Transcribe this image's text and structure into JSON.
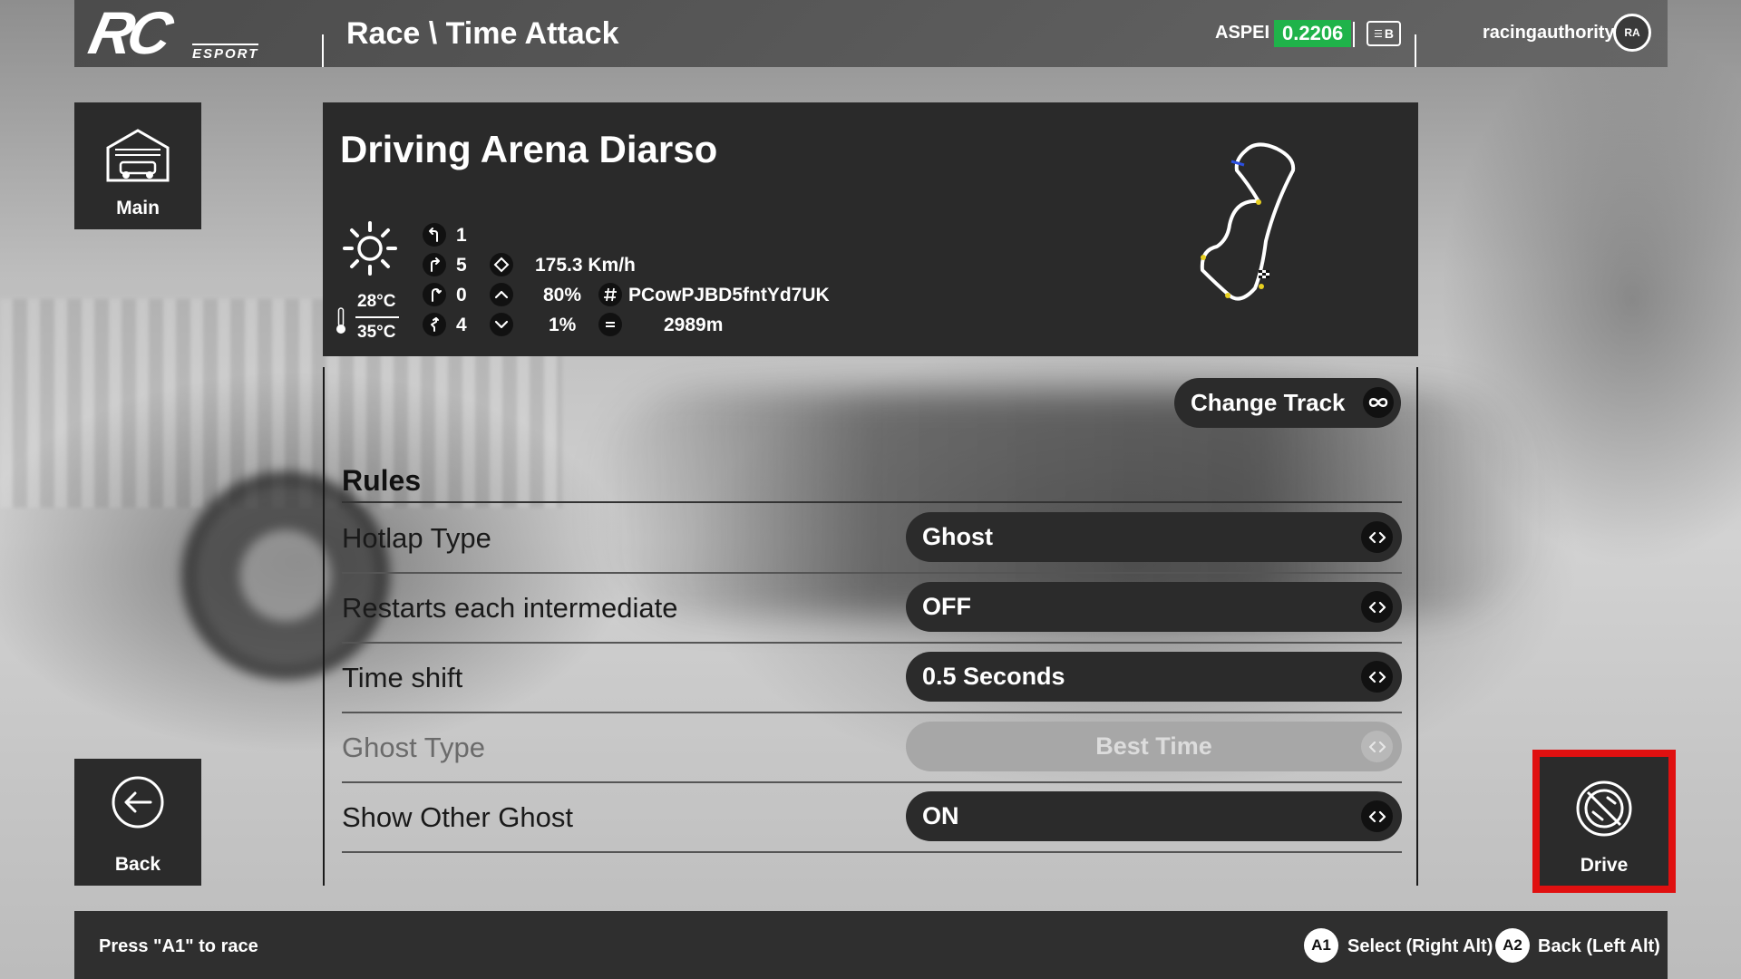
{
  "header": {
    "logo_text": "RC",
    "logo_sub": "ESPORT",
    "title": "Race \\ Time Attack",
    "aspei_label": "ASPEI",
    "aspei_value": "0.2206",
    "aspei_color": "#1fb34a",
    "badge_icon": "id-card-icon",
    "badge_text": "B",
    "username": "racingauthority",
    "avatar_text": "RA"
  },
  "nav": {
    "main_label": "Main",
    "back_label": "Back",
    "drive_label": "Drive",
    "drive_highlight_color": "#e01010"
  },
  "track": {
    "name": "Driving Arena Diarso",
    "weather_icon": "sun-icon",
    "air_temp": "28°C",
    "track_temp": "35°C",
    "left_turns": "1",
    "right_turns": "5",
    "hairpins": "0",
    "chicanes": "4",
    "top_speed": "175.3 Km/h",
    "max_incline": "80%",
    "max_decline": "1%",
    "track_id": "PCowPJBD5fntYd7UK",
    "length": "2989m"
  },
  "change_track_label": "Change Track",
  "rules": {
    "title": "Rules",
    "rows": [
      {
        "label": "Hotlap Type",
        "value": "Ghost",
        "disabled": false
      },
      {
        "label": "Restarts each intermediate",
        "value": "OFF",
        "disabled": false
      },
      {
        "label": "Time shift",
        "value": "0.5 Seconds",
        "disabled": false
      },
      {
        "label": "Ghost Type",
        "value": "Best Time",
        "disabled": true
      },
      {
        "label": "Show Other Ghost",
        "value": "ON",
        "disabled": false
      }
    ]
  },
  "footer": {
    "hint": "Press \"A1\" to race",
    "select_key": "A1",
    "select_label": "Select (Right Alt)",
    "back_key": "A2",
    "back_label": "Back (Left Alt)"
  }
}
